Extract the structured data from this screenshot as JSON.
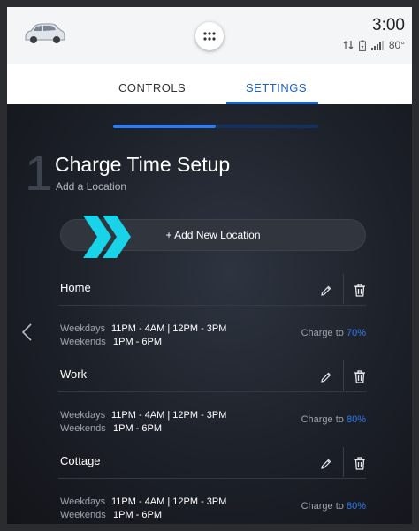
{
  "status_bar": {
    "time": "3:00",
    "temperature": "80°"
  },
  "tabs": [
    {
      "label": "CONTROLS",
      "active": false
    },
    {
      "label": "SETTINGS",
      "active": true
    }
  ],
  "wizard": {
    "progress_fraction": 0.5,
    "step_number": "1",
    "title": "Charge Time Setup",
    "subtitle": "Add a Location",
    "add_button_label": "+ Add New Location"
  },
  "locations": [
    {
      "name": "Home",
      "weekdays_label": "Weekdays",
      "weekdays_time": "11PM - 4AM | 12PM - 3PM",
      "weekends_label": "Weekends",
      "weekends_time": "1PM - 6PM",
      "charge_label": "Charge to",
      "charge_value": "70%"
    },
    {
      "name": "Work",
      "weekdays_label": "Weekdays",
      "weekdays_time": "11PM - 4AM | 12PM - 3PM",
      "weekends_label": "Weekends",
      "weekends_time": "1PM - 6PM",
      "charge_label": "Charge to",
      "charge_value": "80%"
    },
    {
      "name": "Cottage",
      "weekdays_label": "Weekdays",
      "weekdays_time": "11PM - 4AM | 12PM - 3PM",
      "weekends_label": "Weekends",
      "weekends_time": "1PM - 6PM",
      "charge_label": "Charge to",
      "charge_value": "80%"
    }
  ],
  "colors": {
    "accent": "#2e7af0",
    "chevron": "#19d3e8",
    "tab_active": "#1d64c8"
  }
}
